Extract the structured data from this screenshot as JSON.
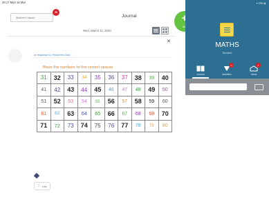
{
  "status_bar": {
    "left": "20:17  Mon 16 Mar",
    "right": "▾ 39% ▮"
  },
  "header": {
    "student_tab": "Student ▾ Classes",
    "badge_count": "20",
    "title": "Journal"
  },
  "entry": {
    "date": "Wed, March 11, 2020",
    "close_icon": "close-icon",
    "response": "In response to: Finish the Grid",
    "instruction": "Move the numbers to the correct spaces",
    "like_label": "Like"
  },
  "add_button": {
    "label": "Add"
  },
  "class": {
    "title": "MATHS",
    "subtitle": "Student"
  },
  "tabs": [
    {
      "label": "Journal",
      "icon": "journal-icon",
      "badge": ""
    },
    {
      "label": "Activities",
      "icon": "activities-icon",
      "badge": "2"
    },
    {
      "label": "Inbox",
      "icon": "inbox-icon",
      "badge": "2"
    }
  ],
  "colors": {
    "header_bg": "#2d6f92",
    "add_green": "#63c23f",
    "badge_red": "#d8232a",
    "instruction": "#d87a1a"
  },
  "grid": [
    [
      {
        "t": "31",
        "c": "#3b9b3b",
        "b": false,
        "s": 8
      },
      {
        "t": "32",
        "c": "#222222",
        "b": true,
        "s": 9
      },
      {
        "t": "33",
        "c": "#3d4aa8",
        "b": false,
        "s": 8
      },
      {
        "t": "34",
        "c": "#e8a23a",
        "b": false,
        "s": 6.5
      },
      {
        "t": "35",
        "c": "#8a3fb0",
        "b": false,
        "s": 8
      },
      {
        "t": "36",
        "c": "#3d4aa8",
        "b": false,
        "s": 8
      },
      {
        "t": "37",
        "c": "#d6328c",
        "b": false,
        "s": 8
      },
      {
        "t": "38",
        "c": "#222222",
        "b": true,
        "s": 9
      },
      {
        "t": "39",
        "c": "#5bb14e",
        "b": false,
        "s": 7
      },
      {
        "t": "40",
        "c": "#222222",
        "b": true,
        "s": 9
      }
    ],
    [
      {
        "t": "41",
        "c": "#555555",
        "b": false,
        "s": 7
      },
      {
        "t": "42",
        "c": "#3d4aa8",
        "b": false,
        "s": 8
      },
      {
        "t": "43",
        "c": "#222222",
        "b": true,
        "s": 9
      },
      {
        "t": "44",
        "c": "#8a3fb0",
        "b": false,
        "s": 8
      },
      {
        "t": "45",
        "c": "#222222",
        "b": true,
        "s": 9
      },
      {
        "t": "46",
        "c": "#4aa3df",
        "b": false,
        "s": 7
      },
      {
        "t": "47",
        "c": "#c977c9",
        "b": false,
        "s": 7
      },
      {
        "t": "48",
        "c": "#3b9b3b",
        "b": false,
        "s": 7
      },
      {
        "t": "49",
        "c": "#222222",
        "b": true,
        "s": 9
      },
      {
        "t": "50",
        "c": "#b13fb0",
        "b": false,
        "s": 7
      }
    ],
    [
      {
        "t": "51",
        "c": "#555555",
        "b": false,
        "s": 7
      },
      {
        "t": "52",
        "c": "#222222",
        "b": true,
        "s": 9
      },
      {
        "t": "53",
        "c": "#e65e9c",
        "b": false,
        "s": 7
      },
      {
        "t": "54",
        "c": "#c977c9",
        "b": false,
        "s": 7
      },
      {
        "t": "55",
        "c": "#5bb14e",
        "b": false,
        "s": 6
      },
      {
        "t": "56",
        "c": "#222222",
        "b": true,
        "s": 9
      },
      {
        "t": "57",
        "c": "#e88a2a",
        "b": false,
        "s": 7
      },
      {
        "t": "58",
        "c": "#222222",
        "b": true,
        "s": 9
      },
      {
        "t": "59",
        "c": "#222222",
        "b": false,
        "s": 7
      },
      {
        "t": "60",
        "c": "#555555",
        "b": false,
        "s": 7
      }
    ],
    [
      {
        "t": "61",
        "c": "#e8532a",
        "b": false,
        "s": 7
      },
      {
        "t": "62",
        "c": "#4aa3df",
        "b": false,
        "s": 6.5
      },
      {
        "t": "63",
        "c": "#222222",
        "b": true,
        "s": 9
      },
      {
        "t": "64",
        "c": "#3d4aa8",
        "b": false,
        "s": 7
      },
      {
        "t": "65",
        "c": "#3b9b3b",
        "b": false,
        "s": 7
      },
      {
        "t": "66",
        "c": "#222222",
        "b": true,
        "s": 9
      },
      {
        "t": "67",
        "c": "#5bb14e",
        "b": false,
        "s": 7
      },
      {
        "t": "68",
        "c": "#8a3fb0",
        "b": false,
        "s": 7
      },
      {
        "t": "69",
        "c": "#e8532a",
        "b": false,
        "s": 7
      },
      {
        "t": "70",
        "c": "#222222",
        "b": true,
        "s": 9
      }
    ],
    [
      {
        "t": "71",
        "c": "#222222",
        "b": true,
        "s": 9
      },
      {
        "t": "72",
        "c": "#3b9b3b",
        "b": false,
        "s": 7.5
      },
      {
        "t": "73",
        "c": "#3d4aa8",
        "b": false,
        "s": 8
      },
      {
        "t": "74",
        "c": "#222222",
        "b": true,
        "s": 9
      },
      {
        "t": "75",
        "c": "#444444",
        "b": false,
        "s": 8
      },
      {
        "t": "76",
        "c": "#3d4aa8",
        "b": false,
        "s": 8
      },
      {
        "t": "77",
        "c": "#222222",
        "b": true,
        "s": 9
      },
      {
        "t": "78",
        "c": "#4aa3df",
        "b": false,
        "s": 7
      },
      {
        "t": "79",
        "c": "#e8a23a",
        "b": false,
        "s": 6
      },
      {
        "t": "80",
        "c": "#e8a23a",
        "b": false,
        "s": 7
      }
    ]
  ]
}
